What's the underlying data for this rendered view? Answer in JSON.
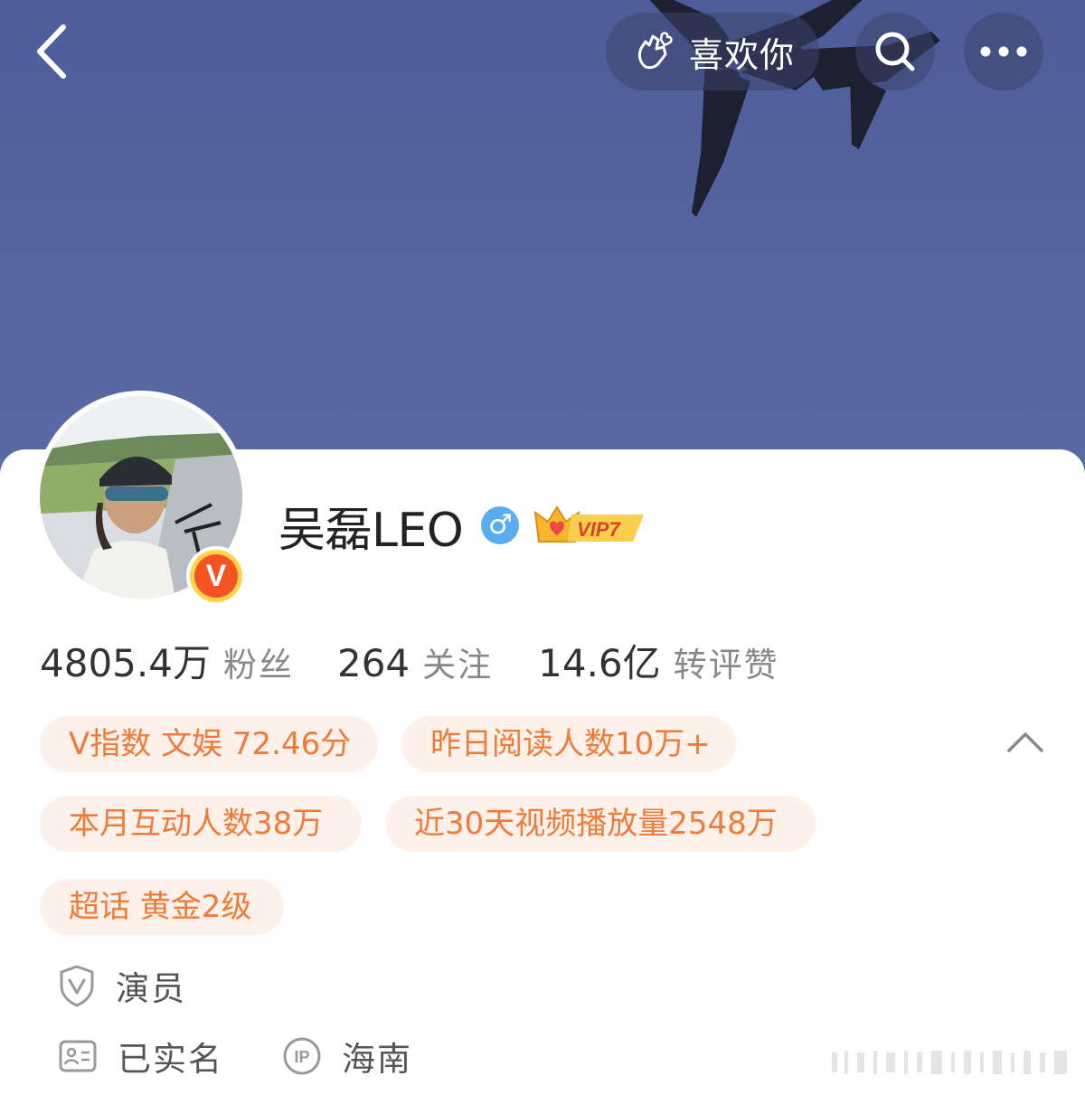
{
  "header": {
    "back_icon": "chevron-left-icon",
    "like_icon": "finger-heart-icon",
    "like_label": "喜欢你",
    "search_icon": "search-icon",
    "more_icon": "more-icon"
  },
  "profile": {
    "name": "吴磊LEO",
    "gender_symbol": "♂",
    "verified_badge": "V",
    "vip_label": "VIP7"
  },
  "stats": [
    {
      "value": "4805.4万",
      "label": "粉丝"
    },
    {
      "value": "264",
      "label": "关注"
    },
    {
      "value": "14.6亿",
      "label": "转评赞"
    }
  ],
  "tags": [
    "V指数 文娱 72.46分",
    "昨日阅读人数10万+",
    "本月互动人数38万",
    "近30天视频播放量2548万",
    "超话 黄金2级"
  ],
  "info": {
    "occupation": "演员",
    "real_name": "已实名",
    "ip_label": "IP",
    "location": "海南"
  },
  "colors": {
    "cover": "#56669f",
    "tag_text": "#f07a3a",
    "tag_bg": "#fdf1ea",
    "gender_blue": "#5aaef0",
    "badge_orange": "#f35422"
  }
}
